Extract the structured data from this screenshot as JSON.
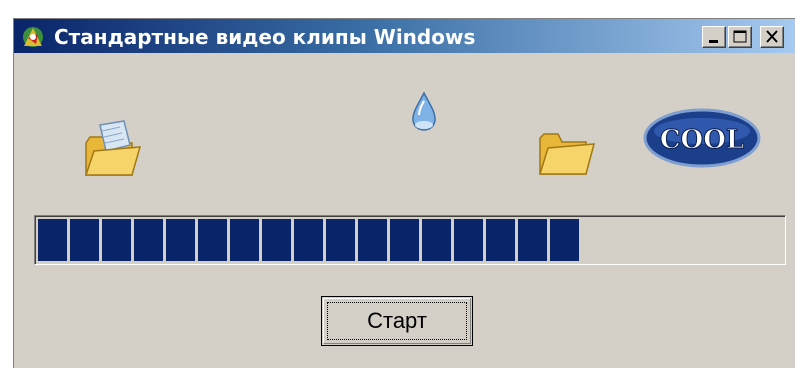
{
  "window": {
    "title": "Стандартные видео клипы Windows",
    "icons": {
      "app": "app-animation-icon",
      "minimize": "minimize-icon",
      "maximize": "maximize-icon",
      "close": "close-icon"
    }
  },
  "animations": [
    {
      "name": "file-copy-animation",
      "icon": "open-folder-icon"
    },
    {
      "name": "recycle-drop-animation",
      "icon": "water-drop-icon"
    },
    {
      "name": "folder-animation",
      "icon": "folder-icon"
    },
    {
      "name": "cool-logo-animation",
      "icon": "cool-logo-icon",
      "text": "COOL"
    }
  ],
  "progress": {
    "value_percent": 73,
    "segments_filled": 17,
    "fill_color": "#0a246a"
  },
  "buttons": {
    "start_label": "Старт"
  },
  "colors": {
    "face": "#d4d0c8",
    "title_start": "#0a246a",
    "title_end": "#a6caf0"
  }
}
